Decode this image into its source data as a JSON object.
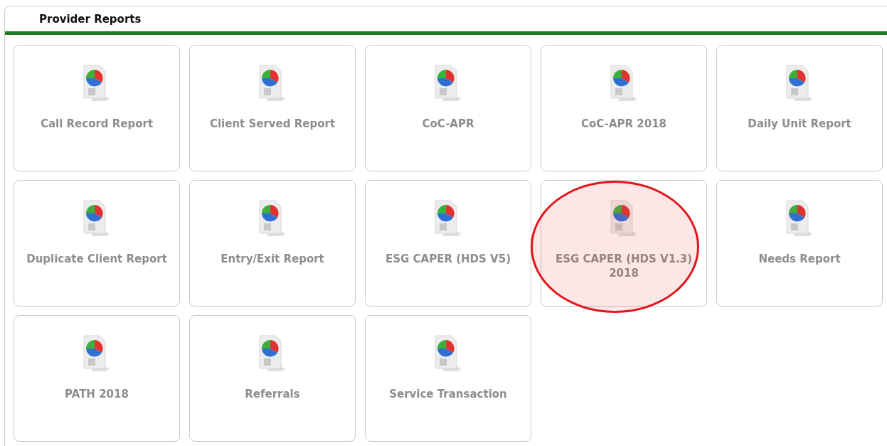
{
  "panel": {
    "title": "Provider Reports"
  },
  "reports": [
    {
      "label": "Call Record Report",
      "highlighted": false
    },
    {
      "label": "Client Served Report",
      "highlighted": false
    },
    {
      "label": "CoC-APR",
      "highlighted": false
    },
    {
      "label": "CoC-APR 2018",
      "highlighted": false
    },
    {
      "label": "Daily Unit Report",
      "highlighted": false
    },
    {
      "label": "Duplicate Client Report",
      "highlighted": false
    },
    {
      "label": "Entry/Exit Report",
      "highlighted": false
    },
    {
      "label": "ESG CAPER (HDS V5)",
      "highlighted": false
    },
    {
      "label": "ESG CAPER (HDS V1.3) 2018",
      "highlighted": true
    },
    {
      "label": "Needs Report",
      "highlighted": false
    },
    {
      "label": "PATH 2018",
      "highlighted": false
    },
    {
      "label": "Referrals",
      "highlighted": false
    },
    {
      "label": "Service Transaction",
      "highlighted": false
    }
  ]
}
